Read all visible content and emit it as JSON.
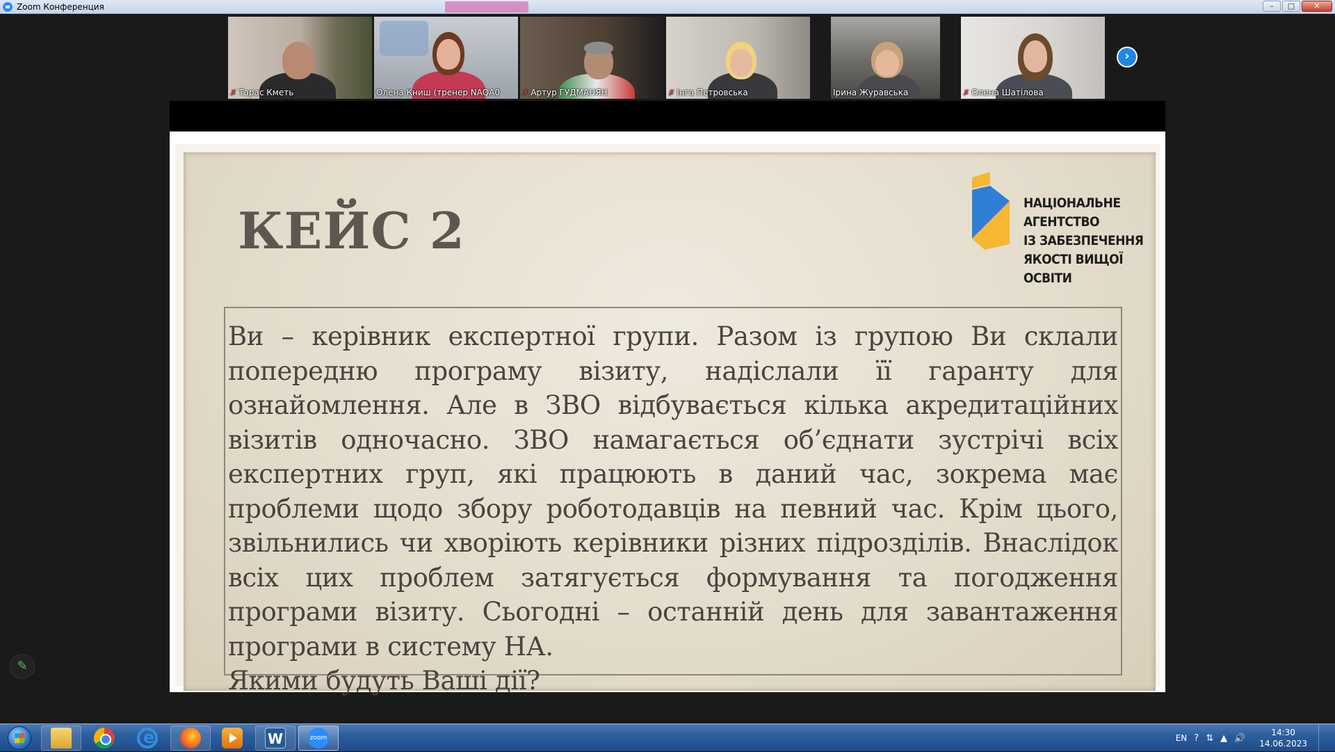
{
  "window": {
    "title": "Zoom Конференция",
    "minimize": "–",
    "maximize": "□",
    "close": "✕"
  },
  "participants": [
    {
      "name": "Тарас Кметь",
      "muted": true
    },
    {
      "name": "Олена Книш (тренер NAQA0",
      "muted": false,
      "active_speaker": true
    },
    {
      "name": "Артур ГУДМАНЯН",
      "muted": true
    },
    {
      "name": "Інга Петровська",
      "muted": true
    },
    {
      "name": "Ірина Журавська",
      "muted": false
    },
    {
      "name": "Олена Шатілова",
      "muted": true
    }
  ],
  "gallery": {
    "next_icon": "chevron-right-icon"
  },
  "slide": {
    "title": "КЕЙС 2",
    "logo_lines": [
      "НАЦІОНАЛЬНЕ",
      "АГЕНТСТВО",
      "ІЗ ЗАБЕЗПЕЧЕННЯ",
      "ЯКОСТІ ВИЩОЇ ОСВІТИ"
    ],
    "body": "Ви – керівник експертної групи. Разом із групою Ви склали попередню програму візиту, надіслали її гаранту для ознайомлення. Але в ЗВО відбувається кілька акредитаційних візитів одночасно. ЗВО намагається об’єднати зустрічі всіх експертних груп, які працюють в даний час, зокрема має проблеми щодо збору роботодавців на певний час. Крім цього, звільнились чи хворіють керівники різних підрозділів. Внаслідок всіх цих проблем затягується формування та погодження програми візиту. Сьогодні – останній день для завантаження програми в систему НА.",
    "question": "Якими будуть Ваші дії?"
  },
  "annotate": {
    "icon": "pencil-icon"
  },
  "taskbar": {
    "apps": [
      "start",
      "explorer",
      "chrome",
      "internet-explorer",
      "firefox",
      "media-player",
      "word",
      "zoom"
    ],
    "word_label": "W",
    "zoom_label": "zoom",
    "language": "EN",
    "time": "14:30",
    "date": "14.06.2023"
  },
  "colors": {
    "accent_blue": "#2d8cff",
    "logo_blue": "#2f7fd6",
    "logo_yellow": "#f6b833",
    "active_speaker": "#9acd32"
  }
}
